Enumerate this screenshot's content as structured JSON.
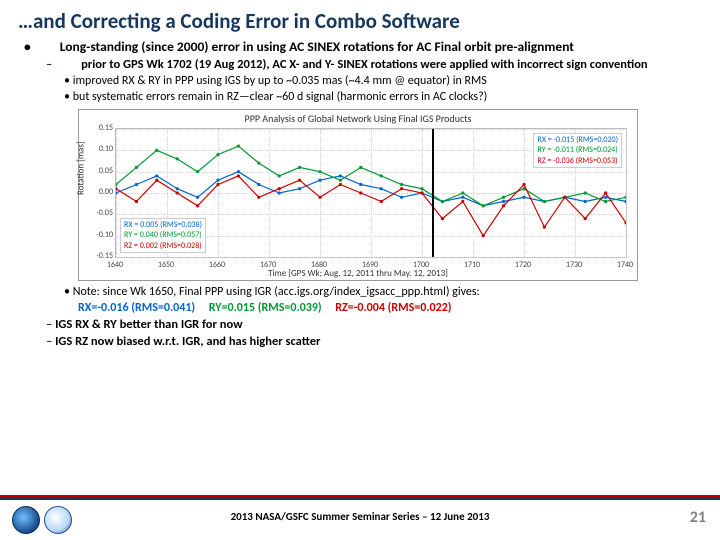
{
  "title": "…and Correcting a Coding Error in Combo Software",
  "bullets": {
    "b0": "Long-standing (since 2000) error in using AC SINEX rotations for AC Final orbit pre-alignment",
    "b1a": "prior to GPS Wk 1702 (19 Aug 2012), AC X- and Y- SINEX rotations were applied with incorrect sign convention",
    "b2a": "improved RX & RY in PPP using IGS by up to ~0.035 mas (~4.4 mm @ equator) in RMS",
    "b2b": "but systematic errors remain in RZ—clear ~60 d signal (harmonic errors in AC clocks?)",
    "b2c": "Note: since Wk 1650, Final PPP using IGR (acc.igs.org/index_igsacc_ppp.html) gives:",
    "b1b": "IGS RX & RY better than IGR for now",
    "b1c": "IGS RZ now biased w.r.t. IGR, and has higher scatter"
  },
  "note_values": {
    "rx": "RX=-0.016 (RMS=0.041)",
    "ry": "RY=0.015 (RMS=0.039)",
    "rz": "RZ=-0.004 (RMS=0.022)"
  },
  "footer": {
    "text": "2013 NASA/GSFC Summer Seminar Series – 12 June 2013",
    "page": "21"
  },
  "chart_data": {
    "type": "line",
    "title": "PPP Analysis of Global Network Using Final IGS Products",
    "xlabel": "Time [GPS Wk; Aug. 12, 2011 thru May. 12, 2013]",
    "ylabel": "Rotation [mas]",
    "xlim": [
      1640,
      1740
    ],
    "ylim": [
      -0.15,
      0.15
    ],
    "xticks": [
      1640,
      1650,
      1660,
      1670,
      1680,
      1690,
      1700,
      1710,
      1720,
      1730,
      1740
    ],
    "yticks": [
      -0.15,
      -0.1,
      -0.05,
      0.0,
      0.05,
      0.1,
      0.15
    ],
    "marker_x": 1702,
    "legend_left": {
      "rx": "RX = 0.005 (RMS=0.038)",
      "ry": "RY = 0.040 (RMS=0.057)",
      "rz": "RZ = 0.002 (RMS=0.028)"
    },
    "legend_right": {
      "rx": "RX = -0.015 (RMS=0.020)",
      "ry": "RY = -0.011 (RMS=0.024)",
      "rz": "RZ = -0.036 (RMS=0.053)"
    },
    "x": [
      1640,
      1644,
      1648,
      1652,
      1656,
      1660,
      1664,
      1668,
      1672,
      1676,
      1680,
      1684,
      1688,
      1692,
      1696,
      1700,
      1704,
      1708,
      1712,
      1716,
      1720,
      1724,
      1728,
      1732,
      1736,
      1740
    ],
    "series": [
      {
        "name": "RX",
        "color": "#0066cc",
        "values": [
          0.0,
          0.02,
          0.04,
          0.01,
          -0.01,
          0.03,
          0.05,
          0.02,
          0.0,
          0.01,
          0.03,
          0.04,
          0.02,
          0.01,
          -0.01,
          0.0,
          -0.02,
          -0.01,
          -0.03,
          -0.02,
          -0.01,
          -0.02,
          -0.01,
          -0.02,
          -0.01,
          -0.02
        ]
      },
      {
        "name": "RY",
        "color": "#009933",
        "values": [
          0.02,
          0.06,
          0.1,
          0.08,
          0.05,
          0.09,
          0.11,
          0.07,
          0.04,
          0.06,
          0.05,
          0.03,
          0.06,
          0.04,
          0.02,
          0.01,
          -0.02,
          0.0,
          -0.03,
          -0.01,
          0.01,
          -0.02,
          -0.01,
          0.0,
          -0.02,
          -0.01
        ]
      },
      {
        "name": "RZ",
        "color": "#cc0000",
        "values": [
          0.01,
          -0.02,
          0.03,
          0.0,
          -0.03,
          0.02,
          0.04,
          -0.01,
          0.01,
          0.03,
          -0.01,
          0.02,
          0.0,
          -0.02,
          0.01,
          0.0,
          -0.06,
          -0.02,
          -0.1,
          -0.03,
          0.02,
          -0.08,
          -0.01,
          -0.06,
          0.0,
          -0.07
        ]
      }
    ]
  }
}
